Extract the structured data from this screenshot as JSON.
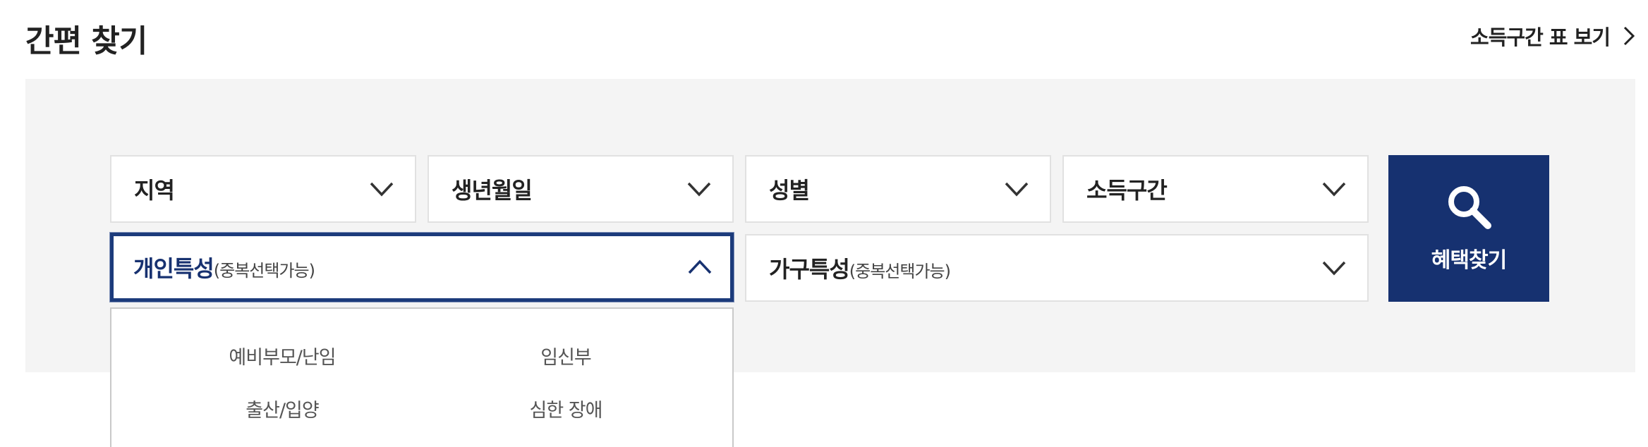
{
  "header": {
    "title": "간편 찾기",
    "income_table_link": "소득구간 표 보기"
  },
  "filters": {
    "region": "지역",
    "birthdate": "생년월일",
    "gender": "성별",
    "income": "소득구간",
    "personal": {
      "label": "개인특성",
      "sub": "(중복선택가능)"
    },
    "household": {
      "label": "가구특성",
      "sub": "(중복선택가능)"
    }
  },
  "search_button": {
    "label": "혜택찾기"
  },
  "personal_options": [
    "예비부모/난임",
    "임신부",
    "출산/입양",
    "심한 장애"
  ],
  "colors": {
    "accent": "#163170",
    "panel_bg": "#f4f4f4"
  },
  "icons": [
    "chevron-right-icon",
    "chevron-down-icon",
    "chevron-up-icon",
    "search-icon"
  ]
}
